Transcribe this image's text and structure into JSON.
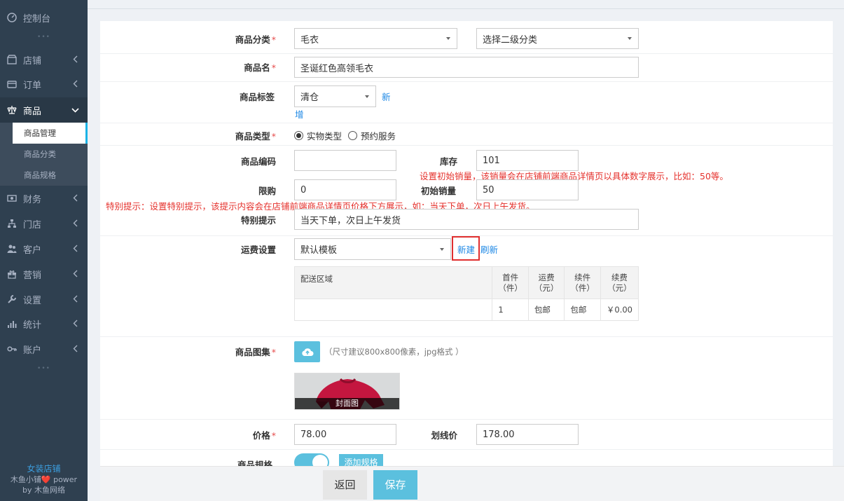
{
  "sidebar": {
    "items": [
      {
        "label": "控制台",
        "icon": "dashboard-icon"
      },
      {
        "label": "店铺",
        "icon": "store-icon"
      },
      {
        "label": "订单",
        "icon": "order-icon"
      },
      {
        "label": "商品",
        "icon": "scale-icon"
      },
      {
        "label": "财务",
        "icon": "money-icon"
      },
      {
        "label": "门店",
        "icon": "sitemap-icon"
      },
      {
        "label": "客户",
        "icon": "users-icon"
      },
      {
        "label": "营销",
        "icon": "gift-icon"
      },
      {
        "label": "设置",
        "icon": "wrench-icon"
      },
      {
        "label": "统计",
        "icon": "bar-chart-icon"
      },
      {
        "label": "账户",
        "icon": "key-icon"
      }
    ],
    "sub_items": [
      "商品管理",
      "商品分类",
      "商品规格"
    ],
    "footer": {
      "shop_name": "女装店铺",
      "power": "木鱼小铺❤️ power",
      "by": "by 木鱼网络"
    }
  },
  "form": {
    "category_label": "商品分类",
    "category_value": "毛衣",
    "category2_value": "选择二级分类",
    "name_label": "商品名",
    "name_value": "圣诞红色高领毛衣",
    "tag_label": "商品标签",
    "tag_value": "清仓",
    "tag_new_1": "新",
    "tag_new_2": "增",
    "type_label": "商品类型",
    "type_options": [
      "实物类型",
      "预约服务"
    ],
    "type_selected": "实物类型",
    "code_label": "商品编码",
    "code_value": "",
    "stock_label": "库存",
    "stock_value": "101",
    "sales_hint": "设置初始销量，该销量会在店铺前端商品详情页以具体数字展示，比如：50等。",
    "limit_label": "限购",
    "limit_value": "0",
    "init_sales_label": "初始销量",
    "init_sales_value": "50",
    "special_hint": "特别提示：设置特别提示，该提示内容会在店铺前端商品详情页价格下方展示，如：当天下单，次日上午发货。",
    "special_label": "特别提示",
    "special_value": "当天下单，次日上午发货",
    "shipping_label": "运费设置",
    "shipping_value": "默认模板",
    "shipping_new": "新建",
    "shipping_refresh": "刷新",
    "gallery_label": "商品图集",
    "gallery_hint": "（尺寸建议800x800像素，jpg格式 ）",
    "cover_caption": "封面图",
    "price_label": "价格",
    "price_value": "78.00",
    "orig_price_label": "划线价",
    "orig_price_value": "178.00",
    "spec_label": "商品规格",
    "spec_add": "添加规格",
    "spec_enabled": true
  },
  "shipping_table": {
    "headers": [
      "配送区域",
      "首件\n（件）",
      "运费\n（元）",
      "续件\n（件）",
      "续费\n（元）"
    ],
    "header_area": "配送区域",
    "h_first_1": "首件",
    "h_first_2": "（件）",
    "h_fee_1": "运费",
    "h_fee_2": "（元）",
    "h_next_1": "续件",
    "h_next_2": "（件）",
    "h_nextfee_1": "续费",
    "h_nextfee_2": "（元）",
    "row": {
      "area": "",
      "first": "1",
      "fee": "包邮",
      "next": "包邮",
      "next_fee": "￥0.00"
    }
  },
  "actions": {
    "back": "返回",
    "save": "保存"
  },
  "colors": {
    "sidebar_bg": "#2f4050",
    "accent": "#5bc0de",
    "link": "#1e88e5",
    "hint_red": "#e5322d",
    "required": "#e64c4c"
  }
}
